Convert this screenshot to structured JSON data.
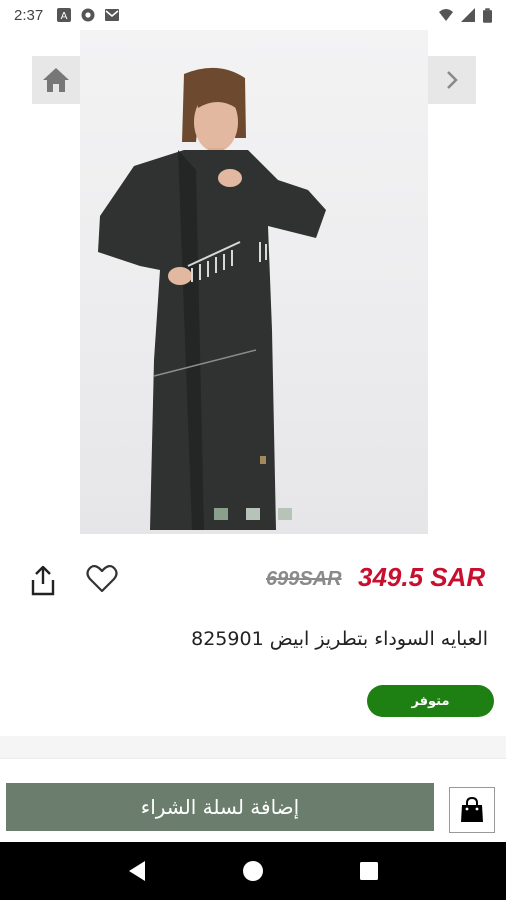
{
  "status_bar": {
    "time": "2:37",
    "notification_icons": [
      "font-icon",
      "chrome-icon",
      "gmail-icon"
    ],
    "system_icons": [
      "wifi-icon",
      "signal-icon",
      "battery-icon"
    ]
  },
  "gallery": {
    "home_icon": "home-icon",
    "next_icon": "chevron-right-icon",
    "image_alt": "Woman wearing black abaya with white embroidery",
    "dot_count": 3,
    "active_dot": 0
  },
  "product": {
    "old_price": "699SAR",
    "new_price": "349.5 SAR",
    "title": "العبايه السوداء بتطريز ابيض 825901",
    "stock_label": "متوفر"
  },
  "actions": {
    "share_icon": "share-icon",
    "wishlist_icon": "heart-icon",
    "add_to_cart_label": "إضافة لسلة الشراء",
    "cart_icon": "shopping-bag-icon"
  },
  "colors": {
    "price_red": "#c8102e",
    "stock_green": "#1e7f12",
    "cart_button": "#6b7d6c"
  }
}
